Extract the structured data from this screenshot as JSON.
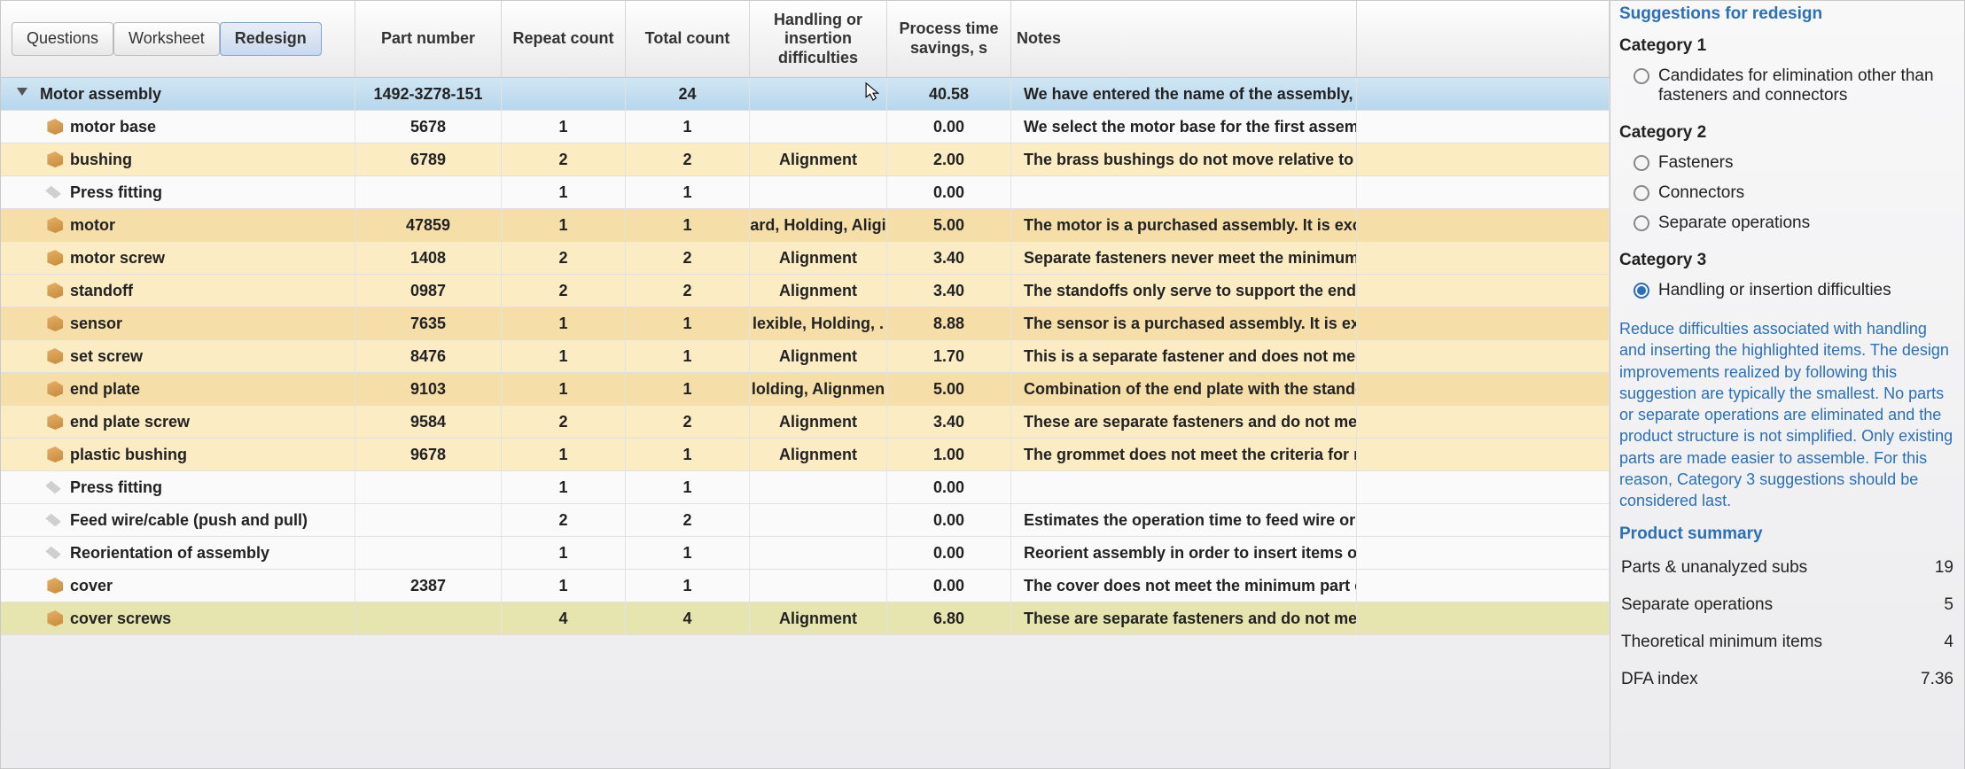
{
  "tabs": {
    "questions": "Questions",
    "worksheet": "Worksheet",
    "redesign": "Redesign"
  },
  "columns": {
    "part_number": "Part number",
    "repeat_count": "Repeat count",
    "total_count": "Total count",
    "difficulties": "Handling or insertion difficulties",
    "process_time": "Process time savings, s",
    "notes": "Notes"
  },
  "rows": [
    {
      "kind": "assembly",
      "name": "Motor assembly",
      "part": "1492-3Z78-151",
      "repeat": "",
      "total": "24",
      "diff": "",
      "time": "40.58",
      "notes": "We have entered the name of the assembly, som"
    },
    {
      "kind": "part",
      "hl": "plain",
      "name": "motor base",
      "part": "5678",
      "repeat": "1",
      "total": "1",
      "diff": "",
      "time": "0.00",
      "notes": "We select the motor base for the first assembled"
    },
    {
      "kind": "part",
      "hl": "hl-yellow",
      "name": "bushing",
      "part": "6789",
      "repeat": "2",
      "total": "2",
      "diff": "Alignment",
      "time": "2.00",
      "notes": "The brass bushings do not move relative to the i"
    },
    {
      "kind": "op",
      "hl": "plain",
      "name": "Press fitting",
      "part": "",
      "repeat": "1",
      "total": "1",
      "diff": "",
      "time": "0.00",
      "notes": ""
    },
    {
      "kind": "part",
      "hl": "hl-orange",
      "name": "motor",
      "part": "47859",
      "repeat": "1",
      "total": "1",
      "diff": "ard, Holding, Aligi",
      "time": "5.00",
      "notes": "The motor is a purchased assembly. It is exclude"
    },
    {
      "kind": "part",
      "hl": "hl-yellow",
      "name": "motor screw",
      "part": "1408",
      "repeat": "2",
      "total": "2",
      "diff": "Alignment",
      "time": "3.40",
      "notes": "Separate fasteners never meet the minimum par"
    },
    {
      "kind": "part",
      "hl": "hl-yellow",
      "name": "standoff",
      "part": "0987",
      "repeat": "2",
      "total": "2",
      "diff": "Alignment",
      "time": "3.40",
      "notes": "The standoffs only serve to support the end plat"
    },
    {
      "kind": "part",
      "hl": "hl-orange",
      "name": "sensor",
      "part": "7635",
      "repeat": "1",
      "total": "1",
      "diff": "lexible, Holding, .",
      "time": "8.88",
      "notes": "The sensor is a purchased assembly. It is exclud"
    },
    {
      "kind": "part",
      "hl": "hl-yellow",
      "name": "set screw",
      "part": "8476",
      "repeat": "1",
      "total": "1",
      "diff": "Alignment",
      "time": "1.70",
      "notes": "This is a separate fastener and does not meet th"
    },
    {
      "kind": "part",
      "hl": "hl-orange",
      "name": "end plate",
      "part": "9103",
      "repeat": "1",
      "total": "1",
      "diff": "lolding, Alignmen",
      "time": "5.00",
      "notes": "Combination of the end plate with the standoffs"
    },
    {
      "kind": "part",
      "hl": "hl-yellow",
      "name": "end plate screw",
      "part": "9584",
      "repeat": "2",
      "total": "2",
      "diff": "Alignment",
      "time": "3.40",
      "notes": "These are separate fasteners and do not meet th"
    },
    {
      "kind": "part",
      "hl": "hl-yellow",
      "name": "plastic bushing",
      "part": "9678",
      "repeat": "1",
      "total": "1",
      "diff": "Alignment",
      "time": "1.00",
      "notes": "The grommet does not meet the criteria for mini"
    },
    {
      "kind": "op",
      "hl": "plain",
      "name": "Press fitting",
      "part": "",
      "repeat": "1",
      "total": "1",
      "diff": "",
      "time": "0.00",
      "notes": ""
    },
    {
      "kind": "op",
      "hl": "plain",
      "name": "Feed wire/cable (push and pull)",
      "part": "",
      "repeat": "2",
      "total": "2",
      "diff": "",
      "time": "0.00",
      "notes": "Estimates the operation time to feed wire or cab"
    },
    {
      "kind": "op",
      "hl": "plain",
      "name": "Reorientation of assembly",
      "part": "",
      "repeat": "1",
      "total": "1",
      "diff": "",
      "time": "0.00",
      "notes": "Reorient assembly in order to insert items or per"
    },
    {
      "kind": "part",
      "hl": "plain",
      "name": "cover",
      "part": "2387",
      "repeat": "1",
      "total": "1",
      "diff": "",
      "time": "0.00",
      "notes": "The cover does not meet the minimum part crite"
    },
    {
      "kind": "part",
      "hl": "hl-olive",
      "name": "cover screws",
      "part": "",
      "repeat": "4",
      "total": "4",
      "diff": "Alignment",
      "time": "6.80",
      "notes": "These are separate fasteners and do not meet th"
    }
  ],
  "side": {
    "title": "Suggestions for redesign",
    "cat1": "Category 1",
    "cat1_opt": "Candidates for elimination other than fasteners and connectors",
    "cat2": "Category 2",
    "cat2_opts": [
      "Fasteners",
      "Connectors",
      "Separate operations"
    ],
    "cat3": "Category 3",
    "cat3_opt": "Handling or insertion difficulties",
    "desc": "Reduce difficulties associated with handling and inserting the highlighted items. The design improvements realized by following this suggestion are typically the smallest. No parts or separate operations are eliminated and the product structure is not simplified. Only existing parts are made easier to assemble. For this reason, Category 3 suggestions should be considered last.",
    "summary_title": "Product summary",
    "summary": [
      {
        "label": "Parts & unanalyzed subs",
        "value": "19"
      },
      {
        "label": "Separate operations",
        "value": "5"
      },
      {
        "label": "Theoretical minimum items",
        "value": "4"
      },
      {
        "label": "DFA index",
        "value": "7.36"
      }
    ]
  }
}
